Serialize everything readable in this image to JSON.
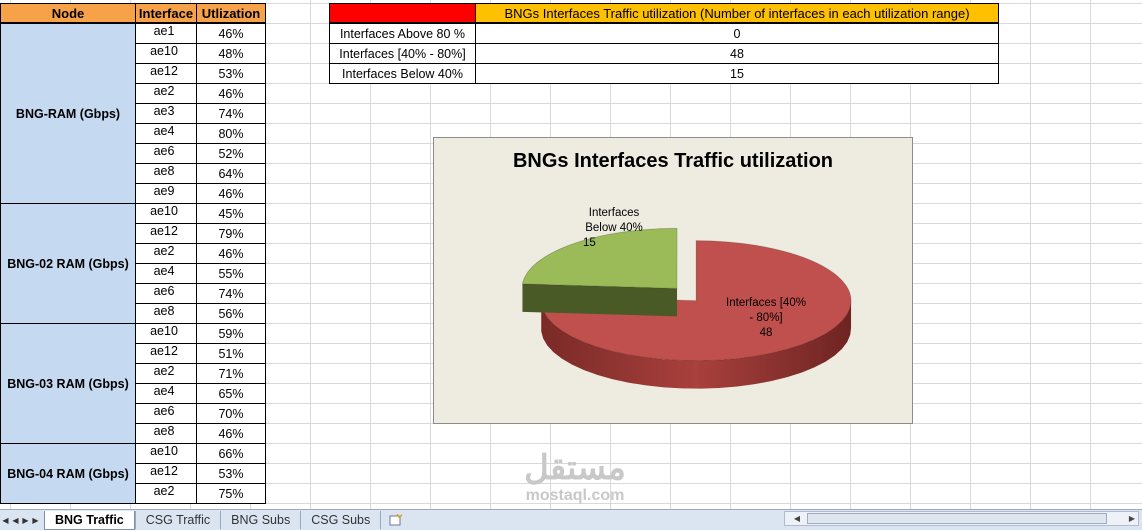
{
  "table": {
    "headers": {
      "node": "Node",
      "interface": "Interface",
      "utilization": "Utlization"
    },
    "groups": [
      {
        "node": "BNG-RAM (Gbps)",
        "rows": [
          {
            "interface": "ae1",
            "utilization": "46%"
          },
          {
            "interface": "ae10",
            "utilization": "48%"
          },
          {
            "interface": "ae12",
            "utilization": "53%"
          },
          {
            "interface": "ae2",
            "utilization": "46%"
          },
          {
            "interface": "ae3",
            "utilization": "74%"
          },
          {
            "interface": "ae4",
            "utilization": "80%"
          },
          {
            "interface": "ae6",
            "utilization": "52%"
          },
          {
            "interface": "ae8",
            "utilization": "64%"
          },
          {
            "interface": "ae9",
            "utilization": "46%"
          }
        ]
      },
      {
        "node": "BNG-02 RAM (Gbps)",
        "rows": [
          {
            "interface": "ae10",
            "utilization": "45%"
          },
          {
            "interface": "ae12",
            "utilization": "79%"
          },
          {
            "interface": "ae2",
            "utilization": "46%"
          },
          {
            "interface": "ae4",
            "utilization": "55%"
          },
          {
            "interface": "ae6",
            "utilization": "74%"
          },
          {
            "interface": "ae8",
            "utilization": "56%"
          }
        ]
      },
      {
        "node": "BNG-03 RAM (Gbps)",
        "rows": [
          {
            "interface": "ae10",
            "utilization": "59%"
          },
          {
            "interface": "ae12",
            "utilization": "51%"
          },
          {
            "interface": "ae2",
            "utilization": "71%"
          },
          {
            "interface": "ae4",
            "utilization": "65%"
          },
          {
            "interface": "ae6",
            "utilization": "70%"
          },
          {
            "interface": "ae8",
            "utilization": "46%"
          }
        ]
      },
      {
        "node": "BNG-04 RAM (Gbps)",
        "rows": [
          {
            "interface": "ae10",
            "utilization": "66%"
          },
          {
            "interface": "ae12",
            "utilization": "53%"
          },
          {
            "interface": "ae2",
            "utilization": "75%"
          }
        ]
      }
    ]
  },
  "summary": {
    "title": "BNGs Interfaces Traffic utilization (Number of interfaces in each utilization range)",
    "rows": [
      {
        "label": "Interfaces Above 80 %",
        "value": "0"
      },
      {
        "label": "Interfaces [40% - 80%]",
        "value": "48"
      },
      {
        "label": "Interfaces Below 40%",
        "value": "15"
      }
    ],
    "colors": {
      "title_fill": "#ffc000",
      "marker_fill": "#ff0000"
    }
  },
  "chart_data": {
    "type": "pie",
    "title": "BNGs Interfaces Traffic utilization",
    "style": "3d-exploded",
    "slices": [
      {
        "label": "Interfaces [40% - 80%]",
        "label_lines": [
          "Interfaces [40%",
          "- 80%]"
        ],
        "value": 48,
        "color": "#c0504d"
      },
      {
        "label": "Interfaces Below 40%",
        "label_lines": [
          "Interfaces",
          "Below 40%"
        ],
        "value": 15,
        "color": "#9bbb59"
      }
    ],
    "background": "#eeece1"
  },
  "tabs": {
    "items": [
      "BNG Traffic",
      "CSG Traffic",
      "BNG Subs",
      "CSG Subs"
    ],
    "active": "BNG Traffic"
  },
  "watermark": {
    "arabic": "مستقل",
    "latin": "mostaql.com"
  }
}
